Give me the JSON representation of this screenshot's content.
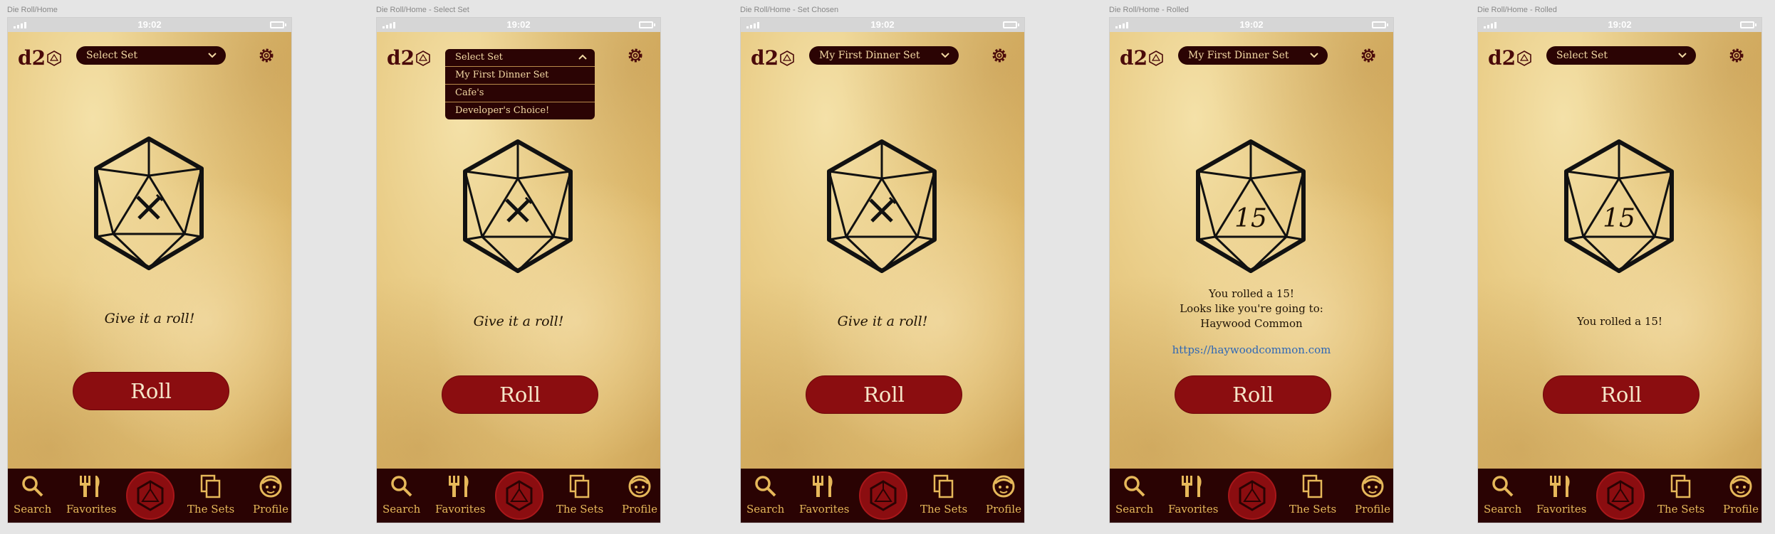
{
  "colors": {
    "accent": "#8b0d10",
    "dark": "#2a0303",
    "gold": "#e6b85a",
    "link": "#2e67b5",
    "parchment": "#e9cc86"
  },
  "status": {
    "time": "19:02"
  },
  "app": {
    "logo": "d2"
  },
  "nav": {
    "search": "Search",
    "favorites": "Favorites",
    "sets": "The Sets",
    "profile": "Profile"
  },
  "icons": {
    "search": "search-icon",
    "favorites": "fork-knife-icon",
    "sets": "copy-icon",
    "profile": "face-icon",
    "settings": "gear-icon",
    "dropdown": "chevron-down-icon",
    "die": "d20-icon"
  },
  "frames": [
    {
      "label": "Die Roll/Home",
      "select": "Select Set",
      "roll": "Roll",
      "message": "Give it a roll!"
    },
    {
      "label": "Die Roll/Home - Select Set",
      "roll": "Roll",
      "message": "Give it a roll!",
      "dropdown": {
        "header": "Select Set",
        "options": [
          "My First Dinner Set",
          "Cafe's",
          "Developer's Choice!"
        ]
      }
    },
    {
      "label": "Die Roll/Home - Set Chosen",
      "select": "My First Dinner Set",
      "roll": "Roll",
      "message": "Give it a roll!"
    },
    {
      "label": "Die Roll/Home - Rolled",
      "select": "My First Dinner Set",
      "roll": "Roll",
      "die_value": "15",
      "result_lines": [
        "You rolled a 15!",
        "Looks like you're going to:",
        "Haywood Common"
      ],
      "link": "https://haywoodcommon.com"
    },
    {
      "label": "Die Roll/Home - Rolled",
      "select": "Select Set",
      "roll": "Roll",
      "die_value": "15",
      "message": "You rolled a 15!"
    }
  ]
}
